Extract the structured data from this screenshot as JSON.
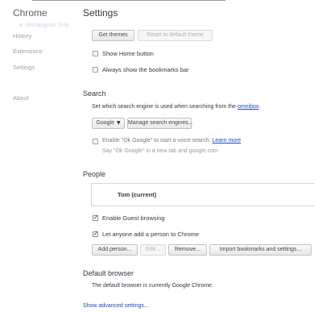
{
  "app": {
    "title": "Chrome",
    "page_title": "Settings",
    "ghost_tab": "Rectangular Snip"
  },
  "sidebar": {
    "items": [
      {
        "label": "History"
      },
      {
        "label": "Extensions"
      },
      {
        "label": "Settings"
      },
      {
        "label": "About"
      }
    ]
  },
  "appearance": {
    "get_themes": "Get themes",
    "reset_theme": "Reset to default theme",
    "show_home": {
      "label": "Show Home button",
      "checked": false
    },
    "bookmarks_bar": {
      "label": "Always show the bookmarks bar",
      "checked": false
    }
  },
  "search": {
    "title": "Search",
    "description": "Set which search engine is used when searching from the",
    "omnibox_link": "omnibox",
    "description_end": ".",
    "engine": "Google",
    "manage_button": "Manage search engines...",
    "ok_google": {
      "label": "Enable \"Ok Google\" to start a voice search.",
      "learn_more": "Learn more",
      "checked": false
    },
    "ok_google_hint": "Say \"Ok Google\" in a new tab and google.com"
  },
  "people": {
    "title": "People",
    "current": "Tom (current)",
    "guest": {
      "label": "Enable Guest browsing",
      "checked": true
    },
    "add_person_check": {
      "label": "Let anyone add a person to Chrome",
      "checked": true
    },
    "buttons": {
      "add": "Add person...",
      "edit": "Edit...",
      "remove": "Remove...",
      "import": "Import bookmarks and settings..."
    }
  },
  "default_browser": {
    "title": "Default browser",
    "text": "The default browser is currently Google Chrome."
  },
  "advanced_link": "Show advanced settings..."
}
